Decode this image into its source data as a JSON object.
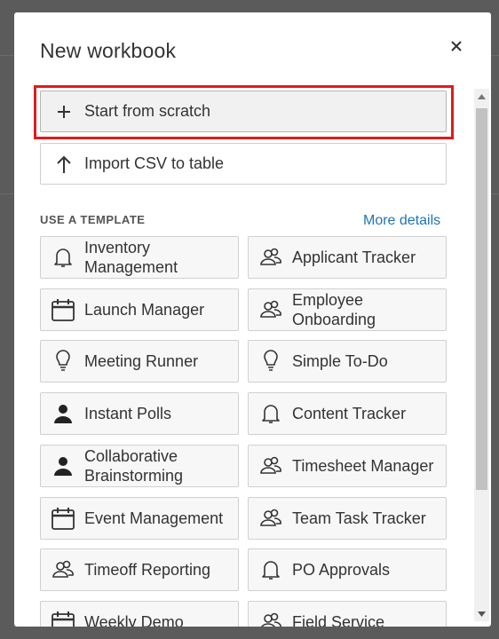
{
  "dialog": {
    "title": "New workbook"
  },
  "actions": {
    "start_label": "Start from scratch",
    "import_label": "Import CSV to table"
  },
  "templates": {
    "section_label": "USE A TEMPLATE",
    "more_details": "More details",
    "items": [
      {
        "label": "Inventory Management",
        "icon": "bell-icon"
      },
      {
        "label": "Applicant Tracker",
        "icon": "people-icon"
      },
      {
        "label": "Launch Manager",
        "icon": "calendar-icon"
      },
      {
        "label": "Employee Onboarding",
        "icon": "people-icon"
      },
      {
        "label": "Meeting Runner",
        "icon": "lightbulb-icon"
      },
      {
        "label": "Simple To-Do",
        "icon": "lightbulb-icon"
      },
      {
        "label": "Instant Polls",
        "icon": "person-icon"
      },
      {
        "label": "Content Tracker",
        "icon": "bell-icon"
      },
      {
        "label": "Collaborative Brainstorming",
        "icon": "person-icon"
      },
      {
        "label": "Timesheet Manager",
        "icon": "people-icon"
      },
      {
        "label": "Event Management",
        "icon": "calendar-icon"
      },
      {
        "label": "Team Task Tracker",
        "icon": "people-icon"
      },
      {
        "label": "Timeoff Reporting",
        "icon": "people-icon"
      },
      {
        "label": "PO Approvals",
        "icon": "bell-icon"
      },
      {
        "label": "Weekly Demo",
        "icon": "calendar-icon"
      },
      {
        "label": "Field Service",
        "icon": "people-icon"
      }
    ]
  },
  "colors": {
    "link": "#1e73b8",
    "highlight_border": "#e01b1b"
  }
}
